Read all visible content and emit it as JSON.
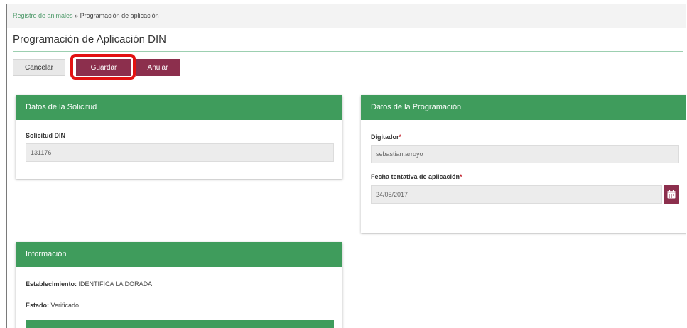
{
  "breadcrumb": {
    "link": "Registro de animales",
    "separator": "»",
    "current": "Programación de aplicación"
  },
  "page": {
    "title": "Programación de Aplicación DIN"
  },
  "toolbar": {
    "cancel_label": "Cancelar",
    "save_label": "Guardar",
    "annul_label": "Anular"
  },
  "solicitud": {
    "header": "Datos de la Solicitud",
    "field_label": "Solicitud DIN",
    "field_value": "131176"
  },
  "programacion": {
    "header": "Datos de la Programación",
    "digitador_label": "Digitador",
    "digitador_value": "sebastian.arroyo",
    "fecha_label": "Fecha tentativa de aplicación",
    "fecha_value": "24/05/2017",
    "required_mark": "*"
  },
  "informacion": {
    "header": "Información",
    "establecimiento_label": "Establecimiento:",
    "establecimiento_value": "IDENTIFICA LA DORADA",
    "estado_label": "Estado:",
    "estado_value": "Verificado"
  },
  "icons": {
    "calendar": "calendar-icon"
  },
  "colors": {
    "panel_header": "#3f9c5c",
    "primary_button": "#8c2f4d",
    "highlight": "#e31313"
  }
}
